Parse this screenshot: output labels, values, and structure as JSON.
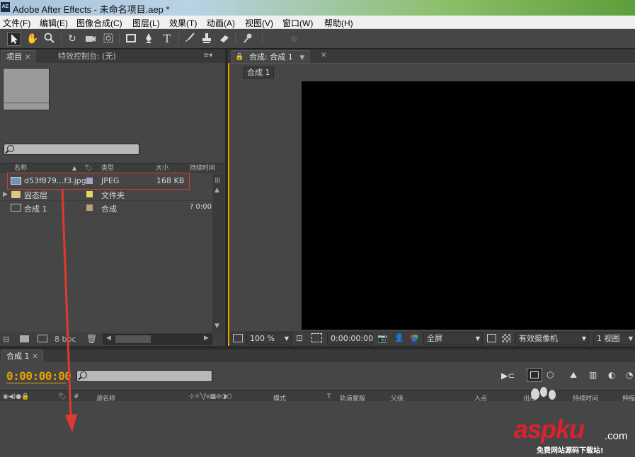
{
  "window": {
    "title": "Adobe After Effects - 未命名项目.aep *",
    "app_icon": "AE"
  },
  "menu": [
    "文件(F)",
    "编辑(E)",
    "图像合成(C)",
    "图层(L)",
    "效果(T)",
    "动画(A)",
    "视图(V)",
    "窗口(W)",
    "帮助(H)"
  ],
  "toolbar": {
    "icons": [
      "selection-tool-icon",
      "hand-tool-icon",
      "zoom-tool-icon",
      "rotate-tool-icon",
      "camera-tool-icon",
      "pan-behind-tool-icon",
      "rectangle-tool-icon",
      "pen-tool-icon",
      "text-tool-icon",
      "brush-tool-icon",
      "clone-stamp-tool-icon",
      "eraser-tool-icon",
      "puppet-pin-tool-icon"
    ],
    "text_tool_glyph": "T"
  },
  "project_panel": {
    "tab_project": "项目",
    "tab_effects": "特效控制台: (无)",
    "columns": {
      "name": "名称",
      "type": "类型",
      "size": "大小",
      "duration": "持续时间"
    },
    "items": [
      {
        "name": "d53f879...f3.jpg",
        "type": "JPEG",
        "size": "168 KB",
        "duration": "",
        "label_color": "#a6a6cf",
        "icon": "image-file-icon"
      },
      {
        "name": "固态层",
        "type": "文件夹",
        "size": "",
        "duration": "",
        "label_color": "#e4d85a",
        "icon": "folder-icon"
      },
      {
        "name": "合成 1",
        "type": "合成",
        "size": "",
        "duration": "? 0:00",
        "label_color": "#b8a07a",
        "icon": "composition-icon"
      }
    ],
    "bpc": "8 bpc"
  },
  "comp_panel": {
    "tab_label": "合成: 合成 1",
    "crumb": "合成 1",
    "zoom": "100 %",
    "timecode": "0:00:00:00",
    "resolution": "全屏",
    "camera": "有效摄像机",
    "views": "1 视图"
  },
  "timeline": {
    "tab_label": "合成 1",
    "timecode": "0:00:00:00",
    "columns": {
      "hash": "#",
      "source_name": "源名称",
      "mode": "模式",
      "t": "T",
      "trkmat": "轨道蒙版",
      "parent": "父级",
      "in": "入点",
      "out": "出点",
      "duration": "持续时间",
      "stretch": "伸缩"
    }
  },
  "watermark": {
    "brand": "aspku",
    "suffix": ".com",
    "tagline": "免费网站源码下载站!"
  },
  "colors": {
    "timecode_orange": "#e8a200",
    "highlight_red": "#e0392f",
    "panel_bg": "#464646"
  }
}
